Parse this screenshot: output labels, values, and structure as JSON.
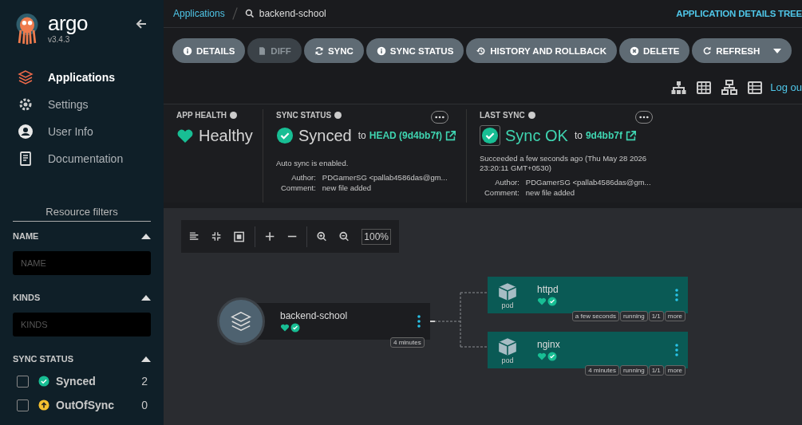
{
  "sidebar": {
    "logo": "argo",
    "version": "v3.4.3",
    "nav": [
      {
        "label": "Applications",
        "selected": true
      },
      {
        "label": "Settings",
        "selected": false
      },
      {
        "label": "User Info",
        "selected": false
      },
      {
        "label": "Documentation",
        "selected": false
      }
    ],
    "filters_title": "Resource filters",
    "filters": [
      {
        "label": "NAME",
        "kind": "input",
        "placeholder": "NAME"
      },
      {
        "label": "KINDS",
        "kind": "input",
        "placeholder": "KINDS"
      },
      {
        "label": "SYNC STATUS",
        "kind": "checks",
        "options": [
          {
            "label": "Synced",
            "count": "2",
            "checked": false
          },
          {
            "label": "OutOfSync",
            "count": "0",
            "checked": false
          }
        ]
      }
    ]
  },
  "breadcrumb": {
    "link": "Applications",
    "current": "backend-school"
  },
  "view_title": "APPLICATION DETAILS TREE",
  "toolbar": [
    {
      "label": "DETAILS",
      "disabled": false
    },
    {
      "label": "DIFF",
      "disabled": true
    },
    {
      "label": "SYNC",
      "disabled": false
    },
    {
      "label": "SYNC STATUS",
      "disabled": false
    },
    {
      "label": "HISTORY AND ROLLBACK",
      "disabled": false
    },
    {
      "label": "DELETE",
      "disabled": false
    },
    {
      "label": "REFRESH",
      "disabled": false,
      "dropdown": true
    }
  ],
  "logout": "Log ou",
  "summary": {
    "app_health": {
      "label": "APP HEALTH",
      "value": "Healthy"
    },
    "sync_status": {
      "label": "SYNC STATUS",
      "value": "Synced",
      "to": "to",
      "revision": "HEAD (9d4bb7f)",
      "note": "Auto sync is enabled.",
      "author_label": "Author:",
      "author": "PDGamerSG <pallab4586das@gm...",
      "comment_label": "Comment:",
      "comment": "new file added"
    },
    "last_sync": {
      "label": "LAST SYNC",
      "value": "Sync OK",
      "to": "to",
      "revision": "9d4bb7f",
      "note": "Succeeded a few seconds ago (Thu May 28 2026 23:20:11 GMT+0530)",
      "author_label": "Author:",
      "author": "PDGamerSG <pallab4586das@gm...",
      "comment_label": "Comment:",
      "comment": "new file added"
    }
  },
  "graph": {
    "zoom": "100%",
    "app": {
      "name": "backend-school",
      "age": "4 minutes"
    },
    "pods": [
      {
        "name": "httpd",
        "kind": "pod",
        "tags": [
          "a few seconds",
          "running",
          "1/1",
          "more"
        ]
      },
      {
        "name": "nginx",
        "kind": "pod",
        "tags": [
          "4 minutes",
          "running",
          "1/1",
          "more"
        ]
      }
    ]
  }
}
